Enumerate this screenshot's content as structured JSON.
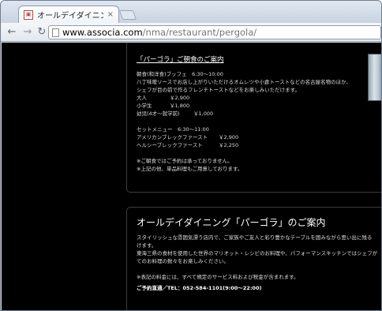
{
  "browser": {
    "tab_title": "オールデイダイニング「パ",
    "tab_favicon": "hotel-favicon",
    "tab_close": "×",
    "nav": {
      "back": "←",
      "forward": "→",
      "reload": "↻"
    },
    "url_host": "www.associa.com",
    "url_path": "/nma/restaurant/pergola/"
  },
  "breakfast": {
    "heading": "「パーゴラ」ご朝食のご案内",
    "buffet_line": "朝食(和洋食)ブッフェ　6:30～10:00",
    "desc1": "八丁味噌ソースでお店し上がりいただけるオムレツや小倉トーストなどの名古屋名物のほか、",
    "desc2": "シェフが目の前で作るフレンチトーストなどをお楽しみいただけます。",
    "prices": [
      {
        "label": "大人",
        "value": "￥2,900"
      },
      {
        "label": "小学生",
        "value": "￥1,800"
      },
      {
        "label": "幼児(4才～就学前)",
        "value": "￥1,000"
      }
    ],
    "set_menu_line": "セットメニュー　6:30～11:00",
    "sets": [
      {
        "label": "アメリカンブレックファースト",
        "value": "￥2,900"
      },
      {
        "label": "ヘルシーブレックファースト",
        "value": "￥2,250"
      }
    ],
    "note1": "※ご朝食ではご予約は承っておりません。",
    "note2": "※上記の他、単品料理もご用意しております。"
  },
  "restaurant": {
    "heading": "オールデイダイニング「パーゴラ」のご案内",
    "desc1": "スタイリッシュな雰囲気漂う店内で、ご家族やご友人と彩り豊かなテーブルを囲みながら思い出に残る",
    "desc2": "けます。",
    "desc3": "東海三県の食材を使用した世界のマリオット・レシピのお料理や、パフォーマンスキッチンではシェフが",
    "desc4": "てのお料理の数々をお楽しみください。",
    "tax_note": "※表記の料金には、すべて規定のサービス料および税金が含まれます。",
    "reservation": "ご予約直通／TEL：052-584-1101(9:00～22:00)"
  }
}
